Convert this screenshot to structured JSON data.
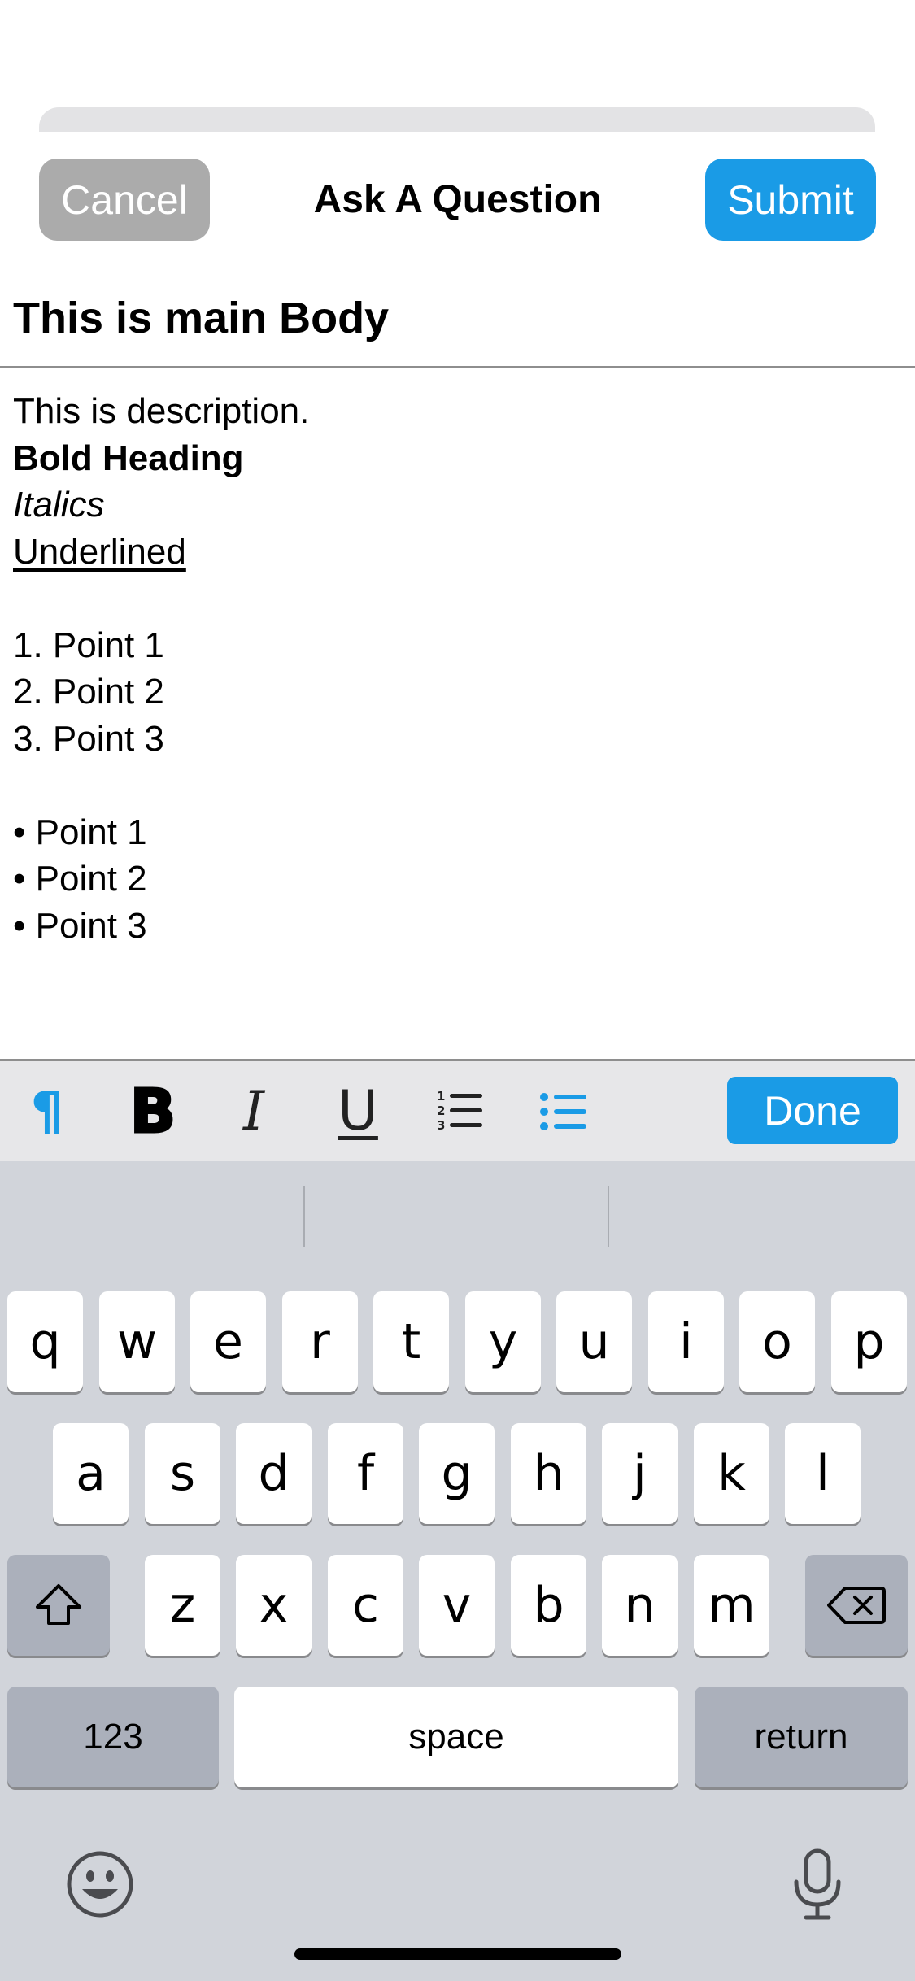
{
  "header": {
    "cancel_label": "Cancel",
    "title": "Ask A Question",
    "submit_label": "Submit"
  },
  "title_field": {
    "value": "This is main Body"
  },
  "description": {
    "plain": "This is description.",
    "bold": "Bold Heading",
    "italic": "Italics",
    "underlined": "Underlined",
    "numbered": [
      "1. Point 1",
      "2. Point 2",
      "3. Point 3"
    ],
    "bullets": [
      "• Point 1",
      "• Point 2",
      "• Point 3"
    ]
  },
  "toolbar": {
    "paragraph_glyph": "¶",
    "bold_glyph": "B",
    "italic_glyph": "I",
    "underline_glyph": "U",
    "icons": [
      "paragraph-icon",
      "bold-icon",
      "italic-icon",
      "underline-icon",
      "numbered-list-icon",
      "bullet-list-icon"
    ],
    "done_label": "Done"
  },
  "keyboard": {
    "row1": [
      "q",
      "w",
      "e",
      "r",
      "t",
      "y",
      "u",
      "i",
      "o",
      "p"
    ],
    "row2": [
      "a",
      "s",
      "d",
      "f",
      "g",
      "h",
      "j",
      "k",
      "l"
    ],
    "row3": [
      "z",
      "x",
      "c",
      "v",
      "b",
      "n",
      "m"
    ],
    "numbers_label": "123",
    "space_label": "space",
    "return_label": "return"
  },
  "colors": {
    "accent": "#1a9be6",
    "cancel": "#ababab",
    "keyboard_bg": "#d1d4da",
    "toolbar_bg": "#e7e7e9"
  }
}
